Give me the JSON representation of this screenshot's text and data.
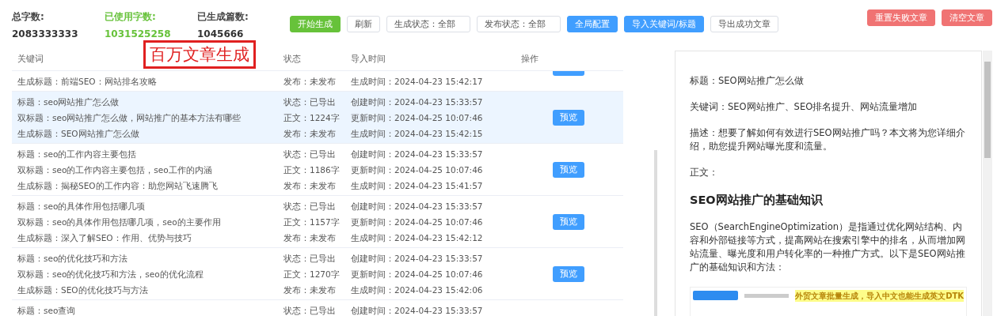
{
  "stats": [
    {
      "label": "总字数:",
      "value": "2083333333"
    },
    {
      "label": "已使用字数:",
      "value": "1031525258"
    },
    {
      "label": "已生成篇数:",
      "value": "1045666"
    }
  ],
  "toolbar": [
    {
      "kind": "start",
      "label": "开始生成"
    },
    {
      "kind": "refresh",
      "label": "刷新"
    },
    {
      "kind": "select",
      "label": "生成状态：全部"
    },
    {
      "kind": "select",
      "label": "发布状态：全部"
    },
    {
      "kind": "config",
      "label": "全局配置"
    },
    {
      "kind": "import",
      "label": "导入关键词/标题"
    },
    {
      "kind": "export",
      "label": "导出成功文章"
    }
  ],
  "right_buttons": [
    {
      "label": "重置失败文章"
    },
    {
      "label": "清空文章"
    }
  ],
  "overlay_caption": "百万文章生成",
  "table": {
    "columns": [
      "关键词",
      "状态",
      "导入时间",
      "操作"
    ],
    "rows": [
      {
        "kind": "clipped_top",
        "selected": false,
        "lines": [
          [
            "生成标题：前端SEO：网站排名攻略",
            "发布：未发布",
            "生成时间：",
            "2024-04-23 15:42:17"
          ]
        ]
      },
      {
        "kind": "full",
        "selected": true,
        "button": "预览",
        "lines": [
          [
            "标题：seo网站推广怎么做",
            "状态：已导出",
            "创建时间：",
            "2024-04-23 15:33:57"
          ],
          [
            "双标题：seo网站推广怎么做，网站推广的基本方法有哪些",
            "正文：1224字",
            "更新时间：",
            "2024-04-25 10:07:46"
          ],
          [
            "生成标题：SEO网站推广怎么做",
            "发布：未发布",
            "生成时间：",
            "2024-04-23 15:42:15"
          ]
        ]
      },
      {
        "kind": "full",
        "selected": false,
        "button": "预览",
        "lines": [
          [
            "标题：seo的工作内容主要包括",
            "状态：已导出",
            "创建时间：",
            "2024-04-23 15:33:57"
          ],
          [
            "双标题：seo的工作内容主要包括，seo工作的内涵",
            "正文：1186字",
            "更新时间：",
            "2024-04-25 10:07:46"
          ],
          [
            "生成标题：揭秘SEO的工作内容：助您网站飞速腾飞",
            "发布：未发布",
            "生成时间：",
            "2024-04-23 15:41:57"
          ]
        ]
      },
      {
        "kind": "full",
        "selected": false,
        "button": "预览",
        "lines": [
          [
            "标题：seo的具体作用包括哪几项",
            "状态：已导出",
            "创建时间：",
            "2024-04-23 15:33:57"
          ],
          [
            "双标题：seo的具体作用包括哪几项，seo的主要作用",
            "正文：1157字",
            "更新时间：",
            "2024-04-25 10:07:46"
          ],
          [
            "生成标题：深入了解SEO：作用、优势与技巧",
            "发布：未发布",
            "生成时间：",
            "2024-04-23 15:42:12"
          ]
        ]
      },
      {
        "kind": "full",
        "selected": false,
        "button": "预览",
        "lines": [
          [
            "标题：seo的优化技巧和方法",
            "状态：已导出",
            "创建时间：",
            "2024-04-23 15:33:57"
          ],
          [
            "双标题：seo的优化技巧和方法，seo的优化流程",
            "正文：1270字",
            "更新时间：",
            "2024-04-25 10:07:46"
          ],
          [
            "生成标题：SEO的优化技巧与方法",
            "发布：未发布",
            "生成时间：",
            "2024-04-23 15:42:06"
          ]
        ]
      },
      {
        "kind": "clipped_bottom",
        "selected": false,
        "lines": [
          [
            "标题：seo查询",
            "状态：已导出",
            "创建时间：",
            "2024-04-23 15:33:57"
          ]
        ]
      }
    ]
  },
  "preview": {
    "blocks": [
      {
        "kind": "para",
        "text": "标题：SEO网站推广怎么做"
      },
      {
        "kind": "para",
        "text": "关键词：SEO网站推广、SEO排名提升、网站流量增加"
      },
      {
        "kind": "para",
        "text": "描述：想要了解如何有效进行SEO网站推广吗？本文将为您详细介绍，助您提升网站曝光度和流量。"
      },
      {
        "kind": "para",
        "text": "正文："
      },
      {
        "kind": "heading",
        "text": "SEO网站推广的基础知识"
      },
      {
        "kind": "para",
        "text": "SEO（SearchEngineOptimization）是指通过优化网站结构、内容和外部链接等方式，提高网站在搜索引擎中的排名，从而增加网站流量、曝光度和用户转化率的一种推广方式。以下是SEO网站推广的基础知识和方法："
      },
      {
        "kind": "screenshot",
        "text": "外贸文章批量生成，导入中文也能生成英文DTK"
      }
    ]
  }
}
